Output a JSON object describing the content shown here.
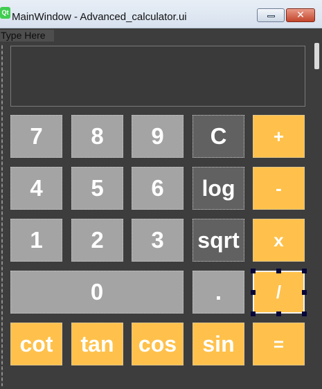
{
  "window": {
    "title": "MainWindow - Advanced_calculator.ui",
    "app_icon": "Qt",
    "minimize_icon": "minimize-icon",
    "close_icon": "close-icon",
    "close_glyph": "✕"
  },
  "menubar": {
    "type_here": "Type Here"
  },
  "display": {
    "value": ""
  },
  "buttons": {
    "seven": "7",
    "eight": "8",
    "nine": "9",
    "clear": "C",
    "plus": "+",
    "four": "4",
    "five": "5",
    "six": "6",
    "log": "log",
    "minus": "-",
    "one": "1",
    "two": "2",
    "three": "3",
    "sqrt": "sqrt",
    "multiply": "x",
    "zero": "0",
    "dot": ".",
    "divide": "/",
    "cot": "cot",
    "tan": "tan",
    "cos": "cos",
    "sin": "sin",
    "equals": "="
  },
  "colors": {
    "background": "#3d3d3d",
    "digit_button": "#a4a4a4",
    "special_button": "#616161",
    "operator_button": "#ffc14b",
    "selection_handle": "#06063a"
  }
}
